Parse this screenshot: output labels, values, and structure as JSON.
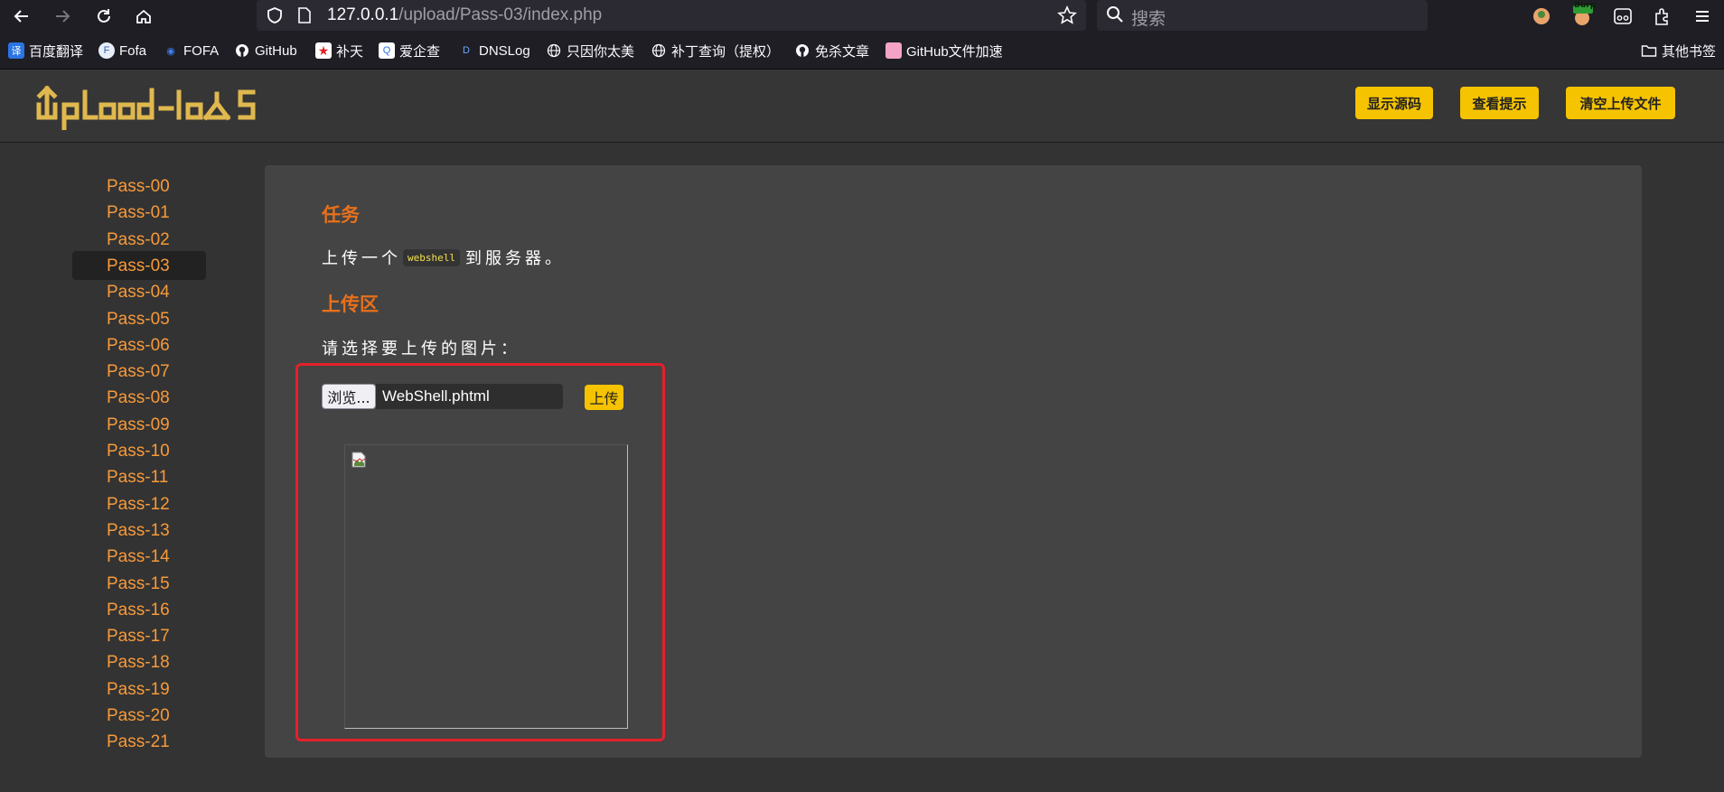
{
  "browser": {
    "url_host": "127.0.0.1",
    "url_path": "/upload/Pass-03/index.php",
    "search_placeholder": "搜索",
    "bookmarks": [
      {
        "label": "百度翻译",
        "icon": "baidu-translate-icon"
      },
      {
        "label": "Fofa",
        "icon": "fofa-icon"
      },
      {
        "label": "FOFA",
        "icon": "fofa-eye-icon"
      },
      {
        "label": "GitHub",
        "icon": "github-icon"
      },
      {
        "label": "补天",
        "icon": "butian-icon"
      },
      {
        "label": "爱企查",
        "icon": "aiqicha-icon"
      },
      {
        "label": "DNSLog",
        "icon": "dnslog-icon"
      },
      {
        "label": "只因你太美",
        "icon": "globe-icon"
      },
      {
        "label": "补丁查询（提权）",
        "icon": "globe-icon"
      },
      {
        "label": "免杀文章",
        "icon": "github-icon"
      },
      {
        "label": "GitHub文件加速",
        "icon": "pink-icon"
      }
    ],
    "other_bookmarks": "其他书签",
    "burp_badge": "Burp"
  },
  "header": {
    "logo_text": "upload-labs",
    "buttons": {
      "show_source": "显示源码",
      "view_hint": "查看提示",
      "clear_uploads": "清空上传文件"
    }
  },
  "sidebar": {
    "active": "Pass-03",
    "items": [
      "Pass-00",
      "Pass-01",
      "Pass-02",
      "Pass-03",
      "Pass-04",
      "Pass-05",
      "Pass-06",
      "Pass-07",
      "Pass-08",
      "Pass-09",
      "Pass-10",
      "Pass-11",
      "Pass-12",
      "Pass-13",
      "Pass-14",
      "Pass-15",
      "Pass-16",
      "Pass-17",
      "Pass-18",
      "Pass-19",
      "Pass-20",
      "Pass-21"
    ]
  },
  "main": {
    "task_title": "任务",
    "task_prefix": "上传一个",
    "task_code": "webshell",
    "task_suffix": "到服务器。",
    "upload_title": "上传区",
    "choose_label": "请选择要上传的图片：",
    "browse_label": "浏览...",
    "file_name": "WebShell.phtml",
    "upload_label": "上传"
  },
  "colors": {
    "accent": "#f5c300",
    "nav_link": "#f79a3a",
    "section_title": "#e8701a",
    "highlight_box": "#e3212b"
  }
}
